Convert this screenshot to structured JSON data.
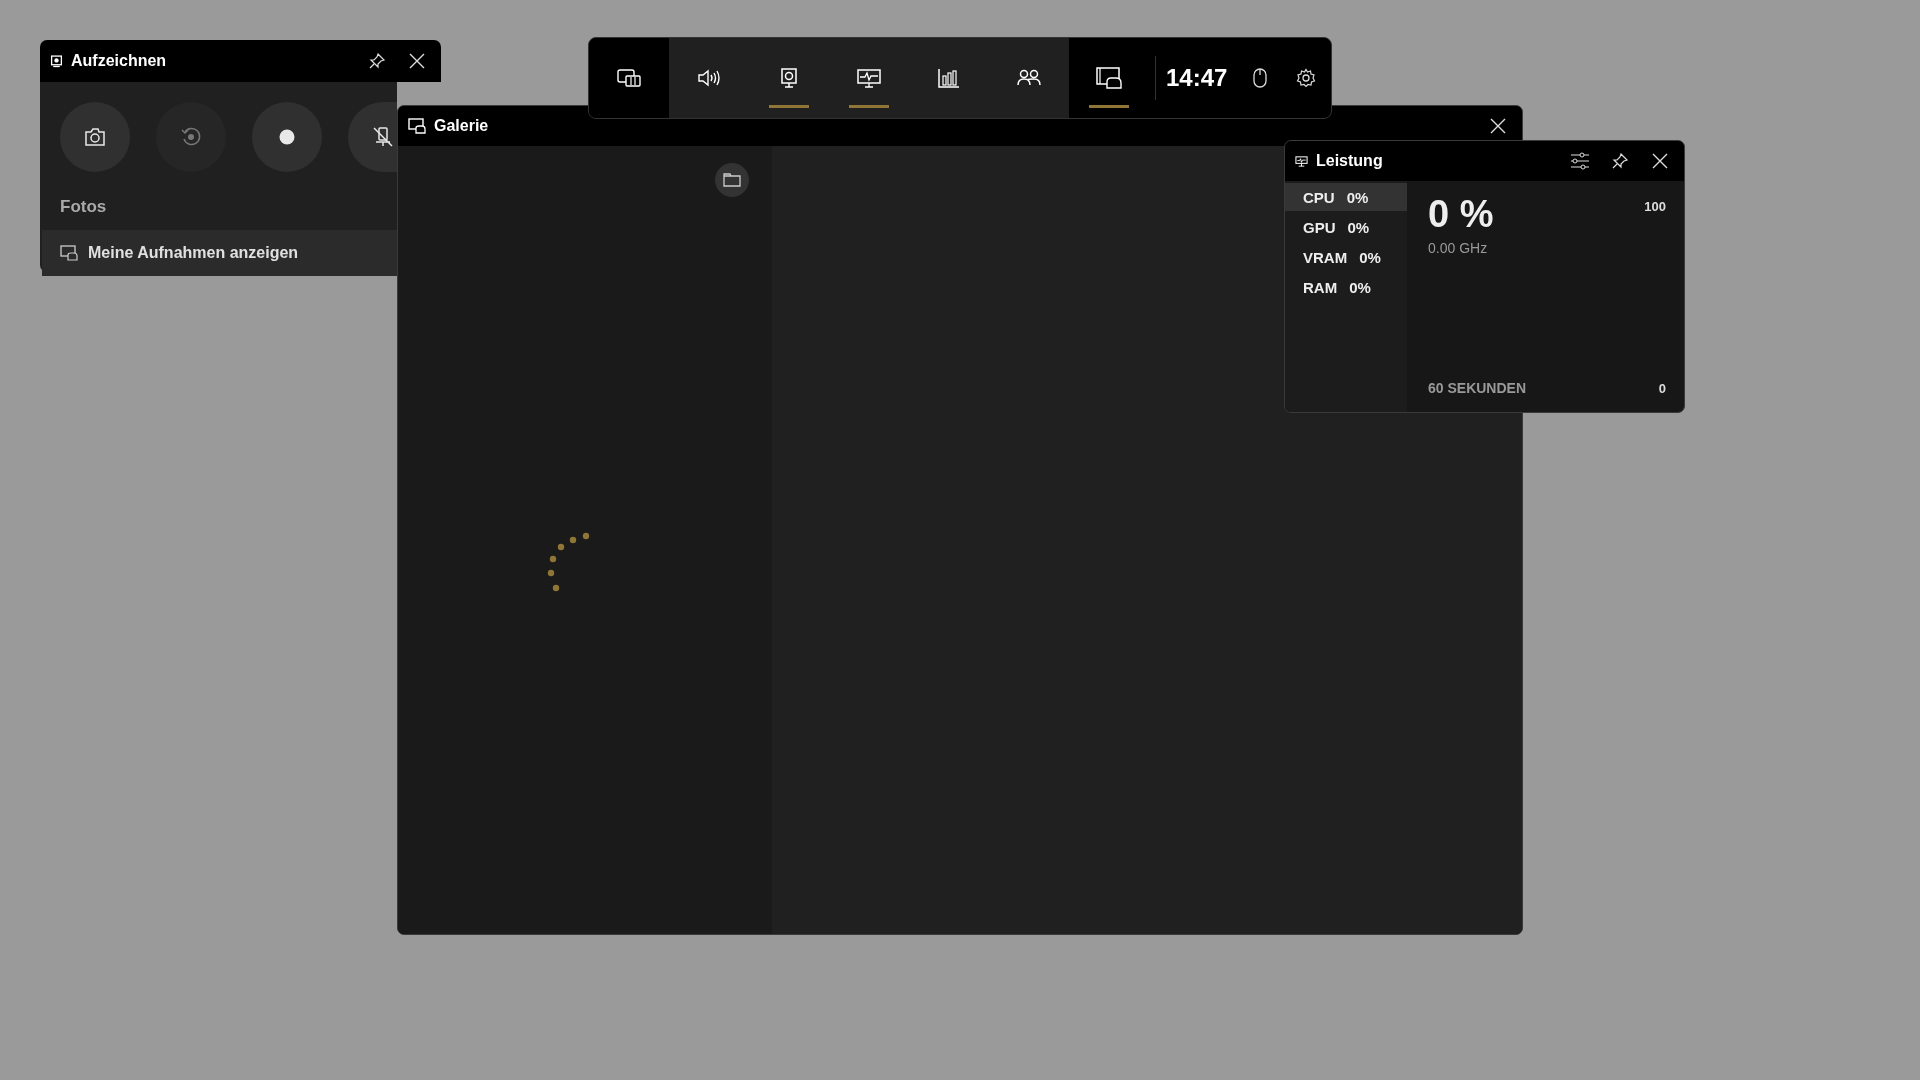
{
  "capture_widget": {
    "title": "Aufzeichnen",
    "buttons": [
      {
        "kind": "screenshot",
        "disabled": false
      },
      {
        "kind": "replay",
        "disabled": true
      },
      {
        "kind": "record",
        "disabled": false
      },
      {
        "kind": "mic-off",
        "disabled": false
      }
    ],
    "section_label": "Fotos",
    "link": "Meine Aufnahmen anzeigen"
  },
  "gallery": {
    "title": "Galerie"
  },
  "top_bar": {
    "widgets": [
      {
        "kind": "menu",
        "selected": false
      },
      {
        "kind": "audio",
        "selected": false
      },
      {
        "kind": "capture",
        "selected": true
      },
      {
        "kind": "performance",
        "selected": true
      },
      {
        "kind": "resources",
        "selected": false
      },
      {
        "kind": "social",
        "selected": false
      },
      {
        "kind": "gallery",
        "selected": true
      }
    ],
    "time": "14:47"
  },
  "performance": {
    "title": "Leistung",
    "metrics": [
      {
        "name": "CPU",
        "value": "0%",
        "selected": true
      },
      {
        "name": "GPU",
        "value": "0%",
        "selected": false
      },
      {
        "name": "VRAM",
        "value": "0%",
        "selected": false
      },
      {
        "name": "RAM",
        "value": "0%",
        "selected": false
      }
    ],
    "reading": "0 %",
    "frequency": "0.00 GHz",
    "axis_max": "100",
    "axis_min": "0",
    "time_span": "60 SEKUNDEN"
  }
}
